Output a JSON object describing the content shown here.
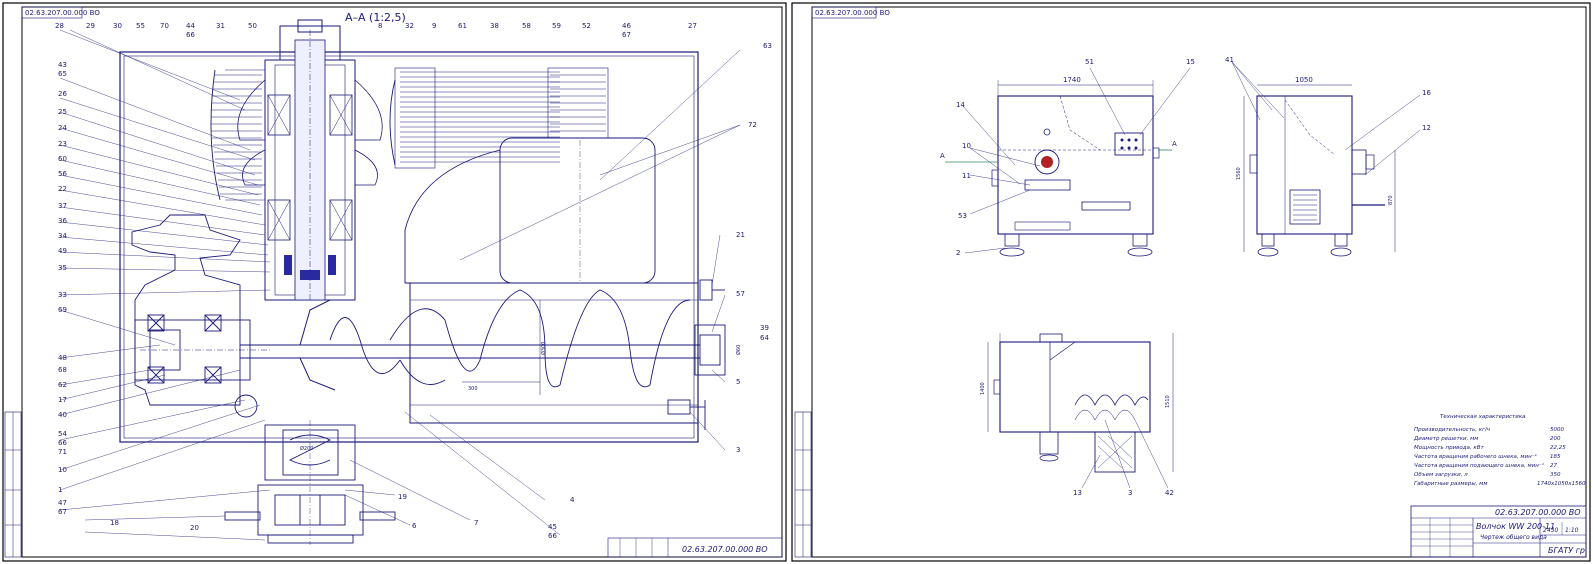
{
  "sheet_code_mirror": "02.63.207.00.000 ВО",
  "left_sheet": {
    "section_title": "А–А (1:2,5)",
    "labels_left": [
      "28",
      "29",
      "30",
      "55",
      "70",
      "44",
      "31",
      "50",
      "43",
      "65",
      "26",
      "25",
      "24",
      "23",
      "60",
      "56",
      "22",
      "37",
      "36",
      "34",
      "49",
      "35",
      "33",
      "69",
      "48",
      "68",
      "62",
      "17",
      "40",
      "54",
      "66",
      "71",
      "10",
      "1",
      "47",
      "67",
      "18",
      "20"
    ],
    "labels_top": [
      "8",
      "32",
      "9",
      "61",
      "38",
      "58",
      "59",
      "52",
      "46",
      "67",
      "27",
      "63",
      "72"
    ],
    "label_66": "66",
    "labels_right": [
      "21",
      "57",
      "39",
      "64",
      "5",
      "3",
      "4",
      "45",
      "66",
      "7",
      "6",
      "19"
    ],
    "dims": {
      "d300a": "Ø300",
      "d300b": "300",
      "d200": "Ø200",
      "d60": "Ø60"
    },
    "stamp_code": "02.63.207.00.000 ВО"
  },
  "right_sheet": {
    "views": {
      "front_labels": [
        "1740",
        "51",
        "15",
        "14",
        "10",
        "11",
        "53",
        "2"
      ],
      "side_labels": [
        "41",
        "1050",
        "16",
        "12",
        "1560",
        "870"
      ],
      "plan_labels": [
        "1400",
        "1510",
        "13",
        "3",
        "42"
      ],
      "section_mark": "А"
    },
    "specs_title": "Техническая характеристика",
    "specs": [
      {
        "name": "Производительность, кг/ч",
        "value": "5000"
      },
      {
        "name": "Диаметр решетки, мм",
        "value": "200"
      },
      {
        "name": "Мощность привода, кВт",
        "value": "22,25"
      },
      {
        "name": "Частота вращения рабочего шнека, мин⁻¹",
        "value": "185"
      },
      {
        "name": "Частота вращения подающего шнека, мин⁻¹",
        "value": "27"
      },
      {
        "name": "Объем загрузки, л",
        "value": "350"
      },
      {
        "name": "Габаритные размеры, мм",
        "value": "1740х1050х1560"
      }
    ],
    "stamp": {
      "code": "02.63.207.00.000 ВО",
      "title1": "Волчок WW 200-11",
      "title2": "Чертеж общего вида",
      "mass": "2450",
      "scale": "1:10",
      "org": "БГАТУ гр."
    }
  },
  "colors": {
    "line": "#1a1a7a",
    "border": "#000000",
    "paper": "#ffffff"
  }
}
